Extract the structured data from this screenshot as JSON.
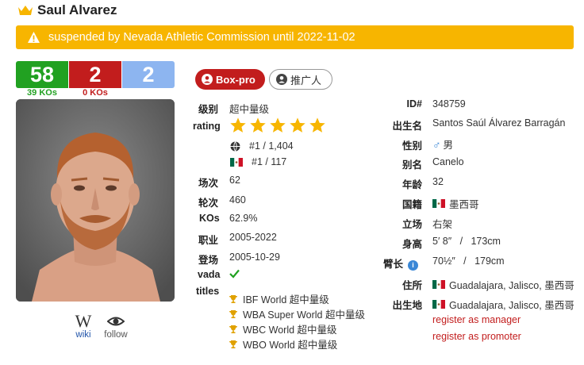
{
  "header": {
    "name": "Saul Alvarez"
  },
  "alert": {
    "text": "suspended by Nevada Athletic Commission until 2022-11-02"
  },
  "record": {
    "wins": "58",
    "losses": "2",
    "draws": "2",
    "wins_ko": "39 KOs",
    "losses_ko": "0 KOs"
  },
  "tags": {
    "boxpro": "Box-pro",
    "promote": "推广人"
  },
  "links": {
    "wiki": "wiki",
    "follow": "follow"
  },
  "profile": {
    "division_label": "级别",
    "division": "超中量级",
    "rating_label": "rating",
    "rating_stars": 5,
    "world_rank": "#1 / 1,404",
    "country_rank": "#1 / 117",
    "bouts_label": "场次",
    "bouts": "62",
    "rounds_label": "轮次",
    "rounds": "460",
    "kos_label": "KOs",
    "kos": "62.9%",
    "career_label": "职业",
    "career": "2005-2022",
    "debut_label": "登场",
    "debut": "2005-10-29",
    "vada_label": "vada",
    "titles_label": "titles",
    "titles": [
      "IBF World 超中量级",
      "WBA Super World 超中量级",
      "WBC World 超中量级",
      "WBO World 超中量级"
    ]
  },
  "details": {
    "id_label": "ID#",
    "id": "348759",
    "birthname_label": "出生名",
    "birthname": "Santos Saúl Álvarez Barragán",
    "sex_label": "性别",
    "sex": "男",
    "alias_label": "别名",
    "alias": "Canelo",
    "age_label": "年龄",
    "age": "32",
    "nationality_label": "国籍",
    "nationality": "墨西哥",
    "stance_label": "立场",
    "stance": "右架",
    "height_label": "身高",
    "height": "5′ 8″   /   173cm",
    "reach_label": "臂长",
    "reach": "70½″   /   179cm",
    "residence_label": "住所",
    "residence": "Guadalajara, Jalisco, 墨西哥",
    "birthplace_label": "出生地",
    "birthplace": "Guadalajara, Jalisco, 墨西哥",
    "register_manager": "register as manager",
    "register_promoter": "register as promoter"
  },
  "colors": {
    "win": "#21a121",
    "loss": "#c21d1d",
    "draw": "#8db5f0",
    "alert": "#f7b500",
    "star": "#f7b500"
  }
}
